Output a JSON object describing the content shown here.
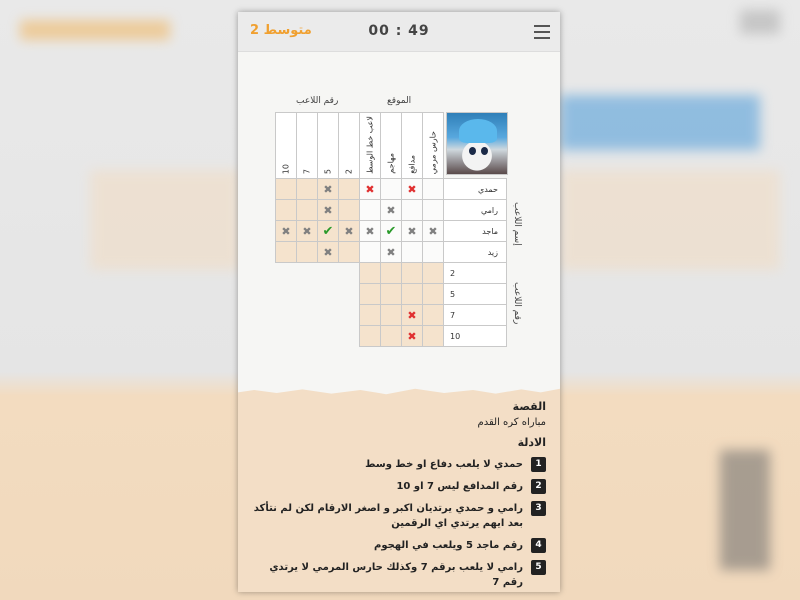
{
  "header": {
    "level": "متوسط 2",
    "timer": "00 : 49"
  },
  "grid": {
    "group_headers": {
      "position": "الموقع",
      "number": "رقم اللاعب"
    },
    "row_group_labels": {
      "names": "إسم اللاعب",
      "numbers": "رقم اللاعب"
    },
    "position_columns": [
      "حارس مرمي",
      "مدافع",
      "مهاجم",
      "لاعب خط الوسط"
    ],
    "number_columns": [
      "2",
      "5",
      "7",
      "10"
    ],
    "name_rows": [
      "حمدي",
      "رامي",
      "ماجد",
      "زيد"
    ],
    "number_rows": [
      "2",
      "5",
      "7",
      "10"
    ]
  },
  "story": {
    "heading": "القصة",
    "text": "مباراه كره القدم"
  },
  "clues": {
    "heading": "الادلة",
    "items": [
      {
        "n": "1",
        "text": "حمدي لا يلعب دفاع او خط وسط"
      },
      {
        "n": "2",
        "text": "رقم المدافع ليس 7 او 10"
      },
      {
        "n": "3",
        "text": "رامي و حمدي يرتديان اكبر و اصغر الارقام لكن لم نتأكد بعد ايهم يرتدي اي الرقمين"
      },
      {
        "n": "4",
        "text": "رقم ماجد 5 ويلعب في الهجوم"
      },
      {
        "n": "5",
        "text": "رامي لا يلعب برقم 7 وكذلك حارس المرمي لا يرتدي رقم 7"
      }
    ]
  },
  "colors": {
    "accent": "#f0a030",
    "cell_tint": "#f5e3cd",
    "x_red": "#e03030",
    "check_green": "#2a9a2a"
  }
}
